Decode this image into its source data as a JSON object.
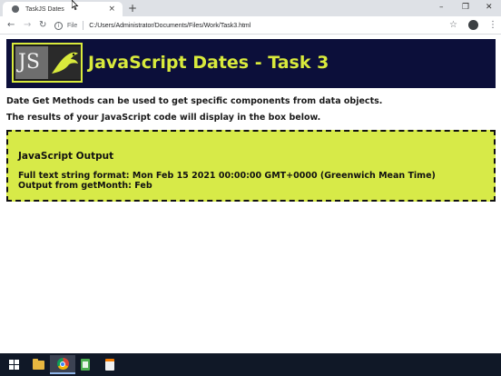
{
  "browser": {
    "tab_title": "TaskJS Dates",
    "tab_close": "×",
    "new_tab": "+",
    "window_controls": {
      "minimize": "–",
      "maximize": "❐",
      "close": "✕"
    },
    "nav": {
      "back": "←",
      "forward": "→",
      "reload": "↻"
    },
    "address": {
      "scheme_label": "File",
      "info_glyph": "i",
      "url": "C:/Users/Administrator/Documents/Files/Work/Task3.html"
    },
    "star_glyph": "☆",
    "menu_glyph": "⋮"
  },
  "page": {
    "banner_logo_text": "JS",
    "banner_title": "JavaScript Dates - Task 3",
    "intro_1": "Date Get Methods can be used to get specific components from data objects.",
    "intro_2": "The results of your JavaScript code will display in the box below.",
    "output": {
      "heading": "JavaScript Output",
      "line_1": "Full text string format: Mon Feb 15 2021 00:00:00 GMT+0000 (Greenwich Mean Time)",
      "line_2": "Output from getMonth: Feb"
    }
  },
  "colors": {
    "banner_bg": "#0c0f3a",
    "accent": "#d9ea3c",
    "output_bg": "#d7ea48",
    "taskbar_bg": "#101827"
  },
  "taskbar": {
    "items": [
      {
        "icon": "windows-start-icon"
      },
      {
        "icon": "file-explorer-icon"
      },
      {
        "icon": "chrome-icon",
        "active": true
      },
      {
        "icon": "notepad-plus-plus-icon"
      },
      {
        "icon": "document-icon"
      }
    ]
  }
}
